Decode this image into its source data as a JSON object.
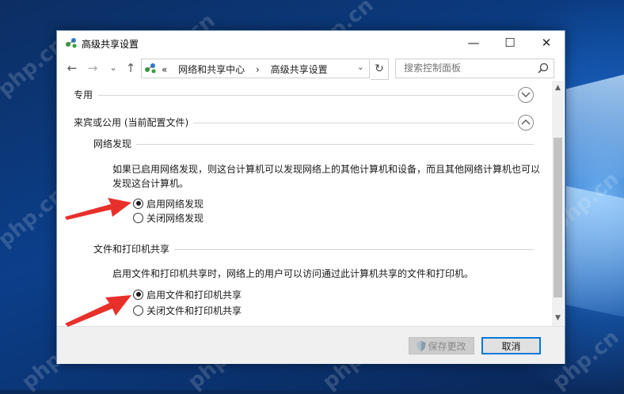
{
  "window": {
    "title": "高级共享设置",
    "minimize": "—",
    "maximize": "☐",
    "close": "✕"
  },
  "nav": {
    "back": "←",
    "forward": "→",
    "history": "⌄",
    "up": "↑"
  },
  "address": {
    "prefix": "«",
    "crumbs": [
      "网络和共享中心",
      "›",
      "高级共享设置"
    ],
    "dropdown": "⌄",
    "refresh": "↻"
  },
  "search": {
    "placeholder": "搜索控制面板"
  },
  "sections": {
    "private_label": "专用",
    "guest_label": "来宾或公用 (当前配置文件)",
    "network_discovery": {
      "heading": "网络发现",
      "description": "如果已启用网络发现，则这台计算机可以发现网络上的其他计算机和设备，而且其他网络计算机也可以发现这台计算机。",
      "option_on": "启用网络发现",
      "option_off": "关闭网络发现",
      "selected": "on"
    },
    "file_sharing": {
      "heading": "文件和打印机共享",
      "description": "启用文件和打印机共享时，网络上的用户可以访问通过此计算机共享的文件和打印机。",
      "option_on": "启用文件和打印机共享",
      "option_off": "关闭文件和打印机共享",
      "selected": "on"
    }
  },
  "footer": {
    "save_label": "保存更改",
    "cancel_label": "取消"
  },
  "watermark": "php.cn",
  "colors": {
    "accent": "#0078d7",
    "annotation_arrow": "#e8302a"
  }
}
